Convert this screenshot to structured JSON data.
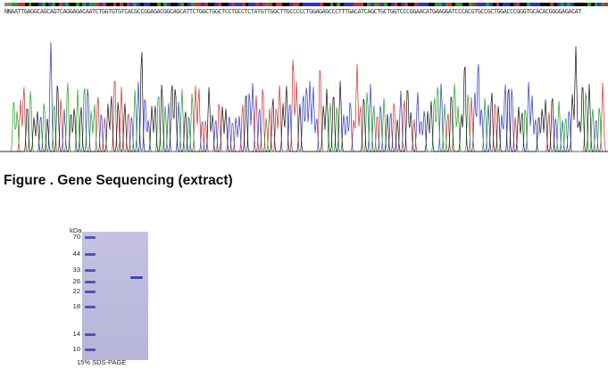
{
  "sequencing": {
    "sequence": "NNAATTGAGGCAGCAGTCAGGAGACAATCTGGTGTGTCACGCCGGAGACGGCAGCATTCTGGCTGGCTCCTGCCTCTATGTTGGCTTGCCCCCTGGAGAGCCCTTTGACATCAGCTGCTGGTCCCGGAACATGAAGGATCCCACGTGCCGCTGGACCCGGGTGCACACGGGGAGACAT",
    "base_colors": {
      "A": "#1e9e1e",
      "C": "#2a35c9",
      "G": "#111111",
      "T": "#d32a2a",
      "N": "#888888"
    }
  },
  "figure": {
    "caption": "Figure . Gene Sequencing (extract)"
  },
  "gel": {
    "unit_label": "kDa",
    "markers": [
      "70",
      "44",
      "33",
      "26",
      "22",
      "18",
      "14",
      "10"
    ],
    "caption": "15% SDS-PAGE",
    "sample_band_kda": "33"
  }
}
